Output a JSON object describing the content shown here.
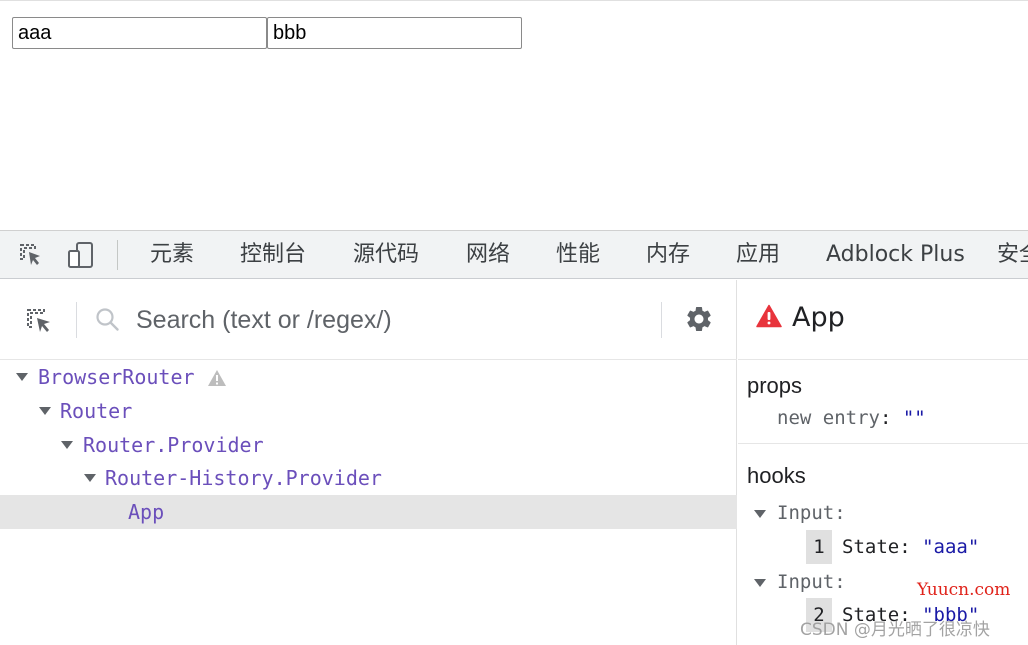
{
  "page": {
    "input1_value": "aaa",
    "input2_value": "bbb"
  },
  "toolbar": {
    "icons": [
      "inspect-element-icon",
      "device-toolbar-icon"
    ],
    "tabs": [
      {
        "label": "元素"
      },
      {
        "label": "控制台"
      },
      {
        "label": "源代码"
      },
      {
        "label": "网络"
      },
      {
        "label": "性能"
      },
      {
        "label": "内存"
      },
      {
        "label": "应用"
      },
      {
        "label": "Adblock Plus"
      },
      {
        "label": "安全"
      }
    ]
  },
  "components": {
    "search_placeholder": "Search (text or /regex/)",
    "tree": [
      {
        "label": "BrowserRouter",
        "depth": 0,
        "expanded": true,
        "warning": true,
        "selected": false
      },
      {
        "label": "Router",
        "depth": 1,
        "expanded": true,
        "warning": false,
        "selected": false
      },
      {
        "label": "Router.Provider",
        "depth": 2,
        "expanded": true,
        "warning": false,
        "selected": false
      },
      {
        "label": "Router-History.Provider",
        "depth": 3,
        "expanded": true,
        "warning": false,
        "selected": false
      },
      {
        "label": "App",
        "depth": 4,
        "expanded": false,
        "warning": false,
        "selected": true
      }
    ]
  },
  "inspector": {
    "title": "App",
    "props_title": "props",
    "props": [
      {
        "key": "new entry",
        "value": "\"\""
      }
    ],
    "hooks_title": "hooks",
    "hooks": [
      {
        "name": "Input:",
        "index": "1",
        "state_label": "State:",
        "value": "\"aaa\""
      },
      {
        "name": "Input:",
        "index": "2",
        "state_label": "State:",
        "value": "\"bbb\""
      }
    ]
  },
  "watermarks": {
    "site": "Yuucn.com",
    "author": "CSDN @月光晒了很凉快"
  },
  "colors": {
    "component_name": "#6b4fbb",
    "warning": "#e8343c",
    "string_value": "#1a1aa6",
    "selected_row": "#e5e5e5",
    "watermark_red": "#e0231b"
  }
}
